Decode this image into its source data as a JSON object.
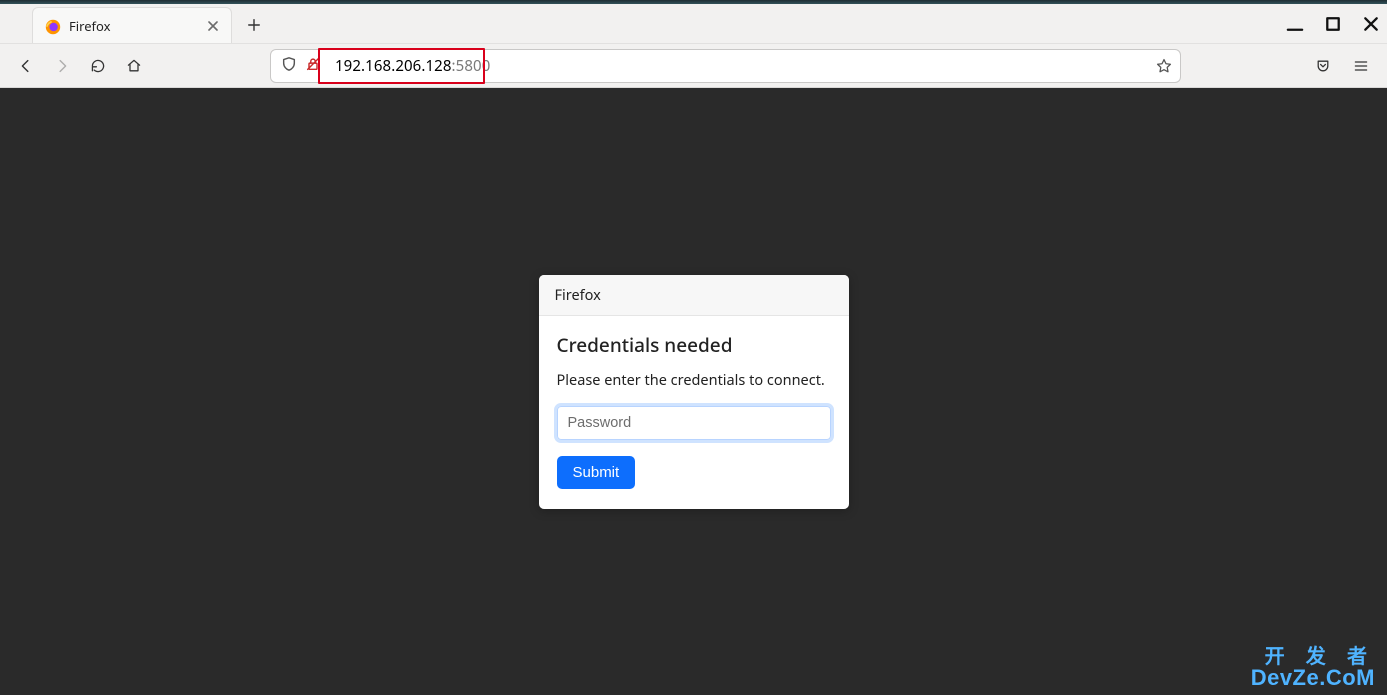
{
  "tab": {
    "title": "Firefox"
  },
  "url": {
    "host": "192.168.206.128",
    "port": ":5800"
  },
  "dialog": {
    "header": "Firefox",
    "title": "Credentials needed",
    "message": "Please enter the credentials to connect.",
    "password_placeholder": "Password",
    "submit_label": "Submit"
  },
  "watermark": {
    "line1": "开 发 者",
    "line2": "DevZe.CoM"
  }
}
